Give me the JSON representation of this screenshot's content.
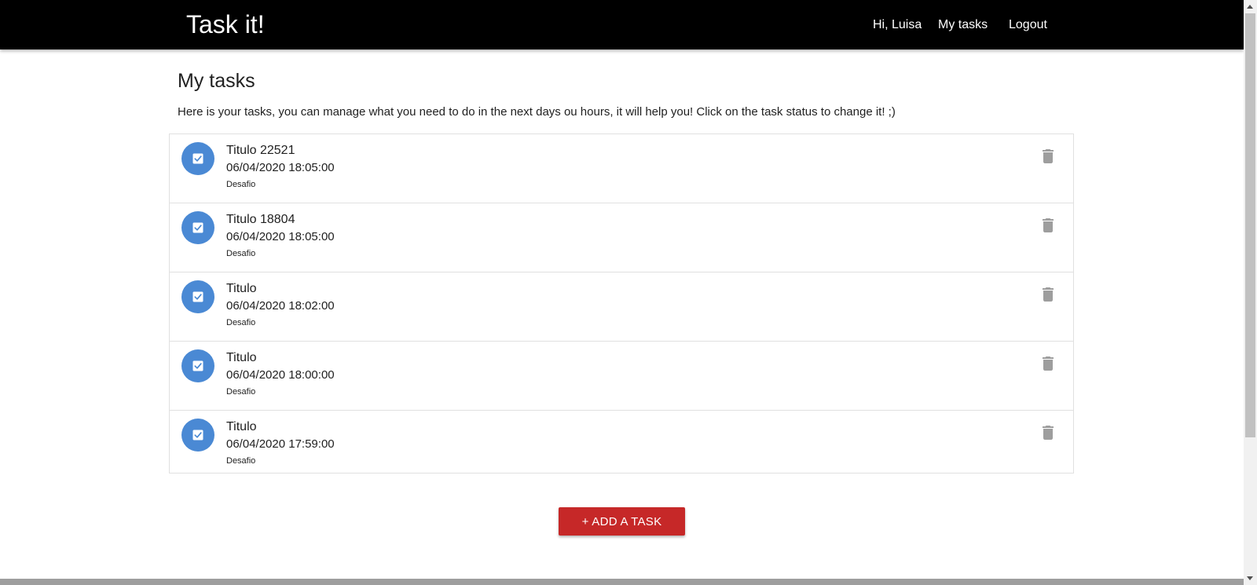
{
  "header": {
    "brand": "Task it!",
    "greeting": "Hi, Luisa",
    "my_tasks": "My tasks",
    "logout": "Logout"
  },
  "page": {
    "title": "My tasks",
    "description": "Here is your tasks, you can manage what you need to do in the next days ou hours, it will help you! Click on the task status to change it! ;)"
  },
  "tasks": [
    {
      "title": "Titulo 22521",
      "datetime": "06/04/2020 18:05:00",
      "category": "Desafio",
      "status_icon": "check-box-icon",
      "delete_icon": "trash-icon"
    },
    {
      "title": "Titulo 18804",
      "datetime": "06/04/2020 18:05:00",
      "category": "Desafio",
      "status_icon": "check-box-icon",
      "delete_icon": "trash-icon"
    },
    {
      "title": "Titulo",
      "datetime": "06/04/2020 18:02:00",
      "category": "Desafio",
      "status_icon": "check-box-icon",
      "delete_icon": "trash-icon"
    },
    {
      "title": "Titulo",
      "datetime": "06/04/2020 18:00:00",
      "category": "Desafio",
      "status_icon": "check-box-icon",
      "delete_icon": "trash-icon"
    },
    {
      "title": "Titulo",
      "datetime": "06/04/2020 17:59:00",
      "category": "Desafio",
      "status_icon": "check-box-icon",
      "delete_icon": "trash-icon"
    }
  ],
  "add_button": {
    "label": "+ ADD A TASK"
  },
  "colors": {
    "navbar": "#000000",
    "status_circle": "#4a89d4",
    "add_button": "#c62828",
    "delete_icon": "#9e9e9e"
  }
}
